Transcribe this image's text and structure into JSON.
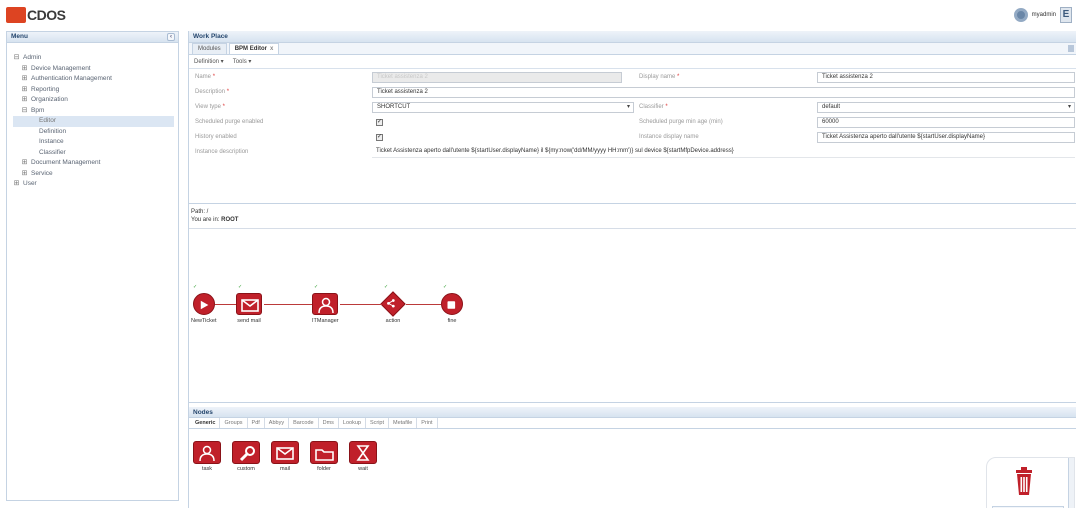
{
  "app": {
    "logo_text": "CDOS",
    "user_name": "myadmin",
    "exit_label": "E"
  },
  "menu": {
    "title": "Menu",
    "collapse": "‹",
    "items": [
      {
        "pm": "⊟",
        "label": "Admin",
        "indent": 0
      },
      {
        "pm": "⊞",
        "label": "Device Management",
        "indent": 1
      },
      {
        "pm": "⊞",
        "label": "Authentication Management",
        "indent": 1
      },
      {
        "pm": "⊞",
        "label": "Reporting",
        "indent": 1
      },
      {
        "pm": "⊞",
        "label": "Organization",
        "indent": 1
      },
      {
        "pm": "⊟",
        "label": "Bpm",
        "indent": 1
      },
      {
        "pm": "",
        "label": "Editor",
        "indent": 2,
        "selected": true
      },
      {
        "pm": "",
        "label": "Definition",
        "indent": 2
      },
      {
        "pm": "",
        "label": "Instance",
        "indent": 2
      },
      {
        "pm": "",
        "label": "Classifier",
        "indent": 2
      },
      {
        "pm": "⊞",
        "label": "Document Management",
        "indent": 1
      },
      {
        "pm": "⊞",
        "label": "Service",
        "indent": 1
      },
      {
        "pm": "⊞",
        "label": "User",
        "indent": 0
      }
    ]
  },
  "workplace": {
    "title": "Work Place",
    "tabs": [
      {
        "label": "Modules",
        "active": false
      },
      {
        "label": "BPM Editor",
        "active": true,
        "close": "x"
      }
    ],
    "menus": [
      "Definition",
      "Tools"
    ],
    "form": {
      "name_label": "Name",
      "name_value": "Ticket assistenza 2",
      "display_label": "Display name",
      "display_value": "Ticket assistenza 2",
      "desc_label": "Description",
      "desc_value": "Ticket assistenza 2",
      "viewtype_label": "View type",
      "viewtype_value": "SHORTCUT",
      "classifier_label": "Classifier",
      "classifier_value": "default",
      "purge_label": "Scheduled purge enabled",
      "purgeage_label": "Scheduled purge min age (min)",
      "purgeage_value": "60000",
      "history_label": "History enabled",
      "instdisplay_label": "Instance display name",
      "instdisplay_value": "Ticket Assistenza aperto dall'utente ${startUser.displayName}",
      "instdesc_label": "Instance description",
      "instdesc_value": "Ticket Assistenza aperto dall'utente ${startUser.displayName} il ${my:now('dd/MM/yyyy HH:mm')} sul device ${startMfpDevice.address}",
      "check": "✓"
    },
    "canvas": {
      "path_text": "Path: /",
      "where_prefix": "You are in: ",
      "where_value": "ROOT",
      "tick": "✓",
      "workflow": [
        {
          "label": "NewTicket",
          "shape": "circle",
          "icon": "play"
        },
        {
          "label": "send mail",
          "shape": "rect",
          "icon": "mail"
        },
        {
          "label": "ITManager",
          "shape": "rect",
          "icon": "user"
        },
        {
          "label": "action",
          "shape": "diamond",
          "icon": "share"
        },
        {
          "label": "fine",
          "shape": "circle",
          "icon": "stop"
        }
      ]
    },
    "nodes": {
      "title": "Nodes",
      "tabs": [
        "Generic",
        "Groups",
        "Pdf",
        "Abbyy",
        "Barcode",
        "Dms",
        "Lookup",
        "Script",
        "Metafile",
        "Print"
      ],
      "palette": [
        {
          "label": "task",
          "icon": "user"
        },
        {
          "label": "custom",
          "icon": "wrench"
        },
        {
          "label": "mail",
          "icon": "mail"
        },
        {
          "label": "folder",
          "icon": "folder"
        },
        {
          "label": "wait",
          "icon": "hourglass"
        }
      ]
    }
  },
  "colors": {
    "node_red": "#c0202a",
    "header_blue": "#25466d",
    "accent_red": "#d42"
  }
}
